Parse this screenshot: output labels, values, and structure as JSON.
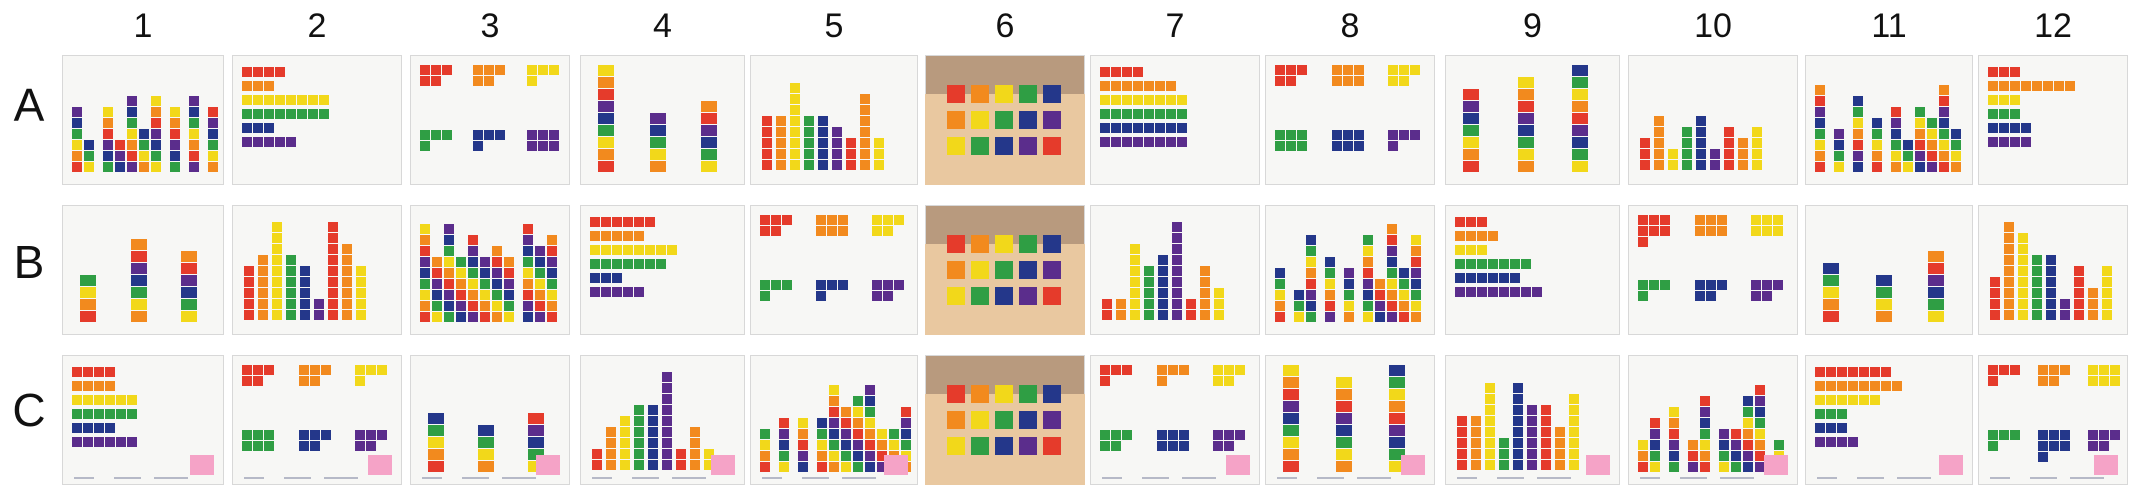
{
  "columns": [
    "1",
    "2",
    "3",
    "4",
    "5",
    "6",
    "7",
    "8",
    "9",
    "10",
    "11",
    "12"
  ],
  "rows": [
    "A",
    "B",
    "C"
  ],
  "colors": {
    "red": "#e53b2b",
    "orange": "#f28a1e",
    "yellow": "#f2d81a",
    "green": "#2f9e44",
    "blue": "#24378a",
    "purple": "#5b2d8c",
    "pink": "#f5a3c7",
    "wood": "#e9c8a0",
    "table": "#b89a7e"
  }
}
